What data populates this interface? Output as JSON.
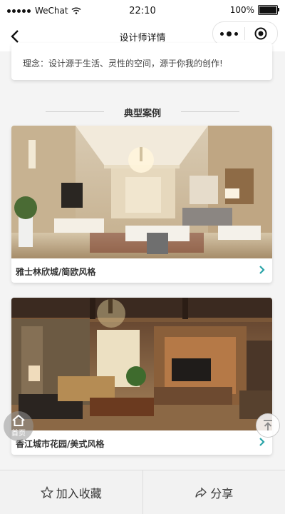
{
  "status_bar": {
    "carrier": "WeChat",
    "time": "22:10",
    "battery": "100%",
    "battery_level": 1.0
  },
  "nav": {
    "title": "设计师详情"
  },
  "designer": {
    "philosophy": "理念：设计源于生活、灵性的空间，源于你我的创作!"
  },
  "section": {
    "title": "典型案例"
  },
  "cases": [
    {
      "title": "雅士林欣城/简欧风格"
    },
    {
      "title": "香江城市花园/美式风格"
    }
  ],
  "floating": {
    "home_label": "首页"
  },
  "bottom_bar": {
    "favorite_label": "加入收藏",
    "share_label": "分享"
  }
}
